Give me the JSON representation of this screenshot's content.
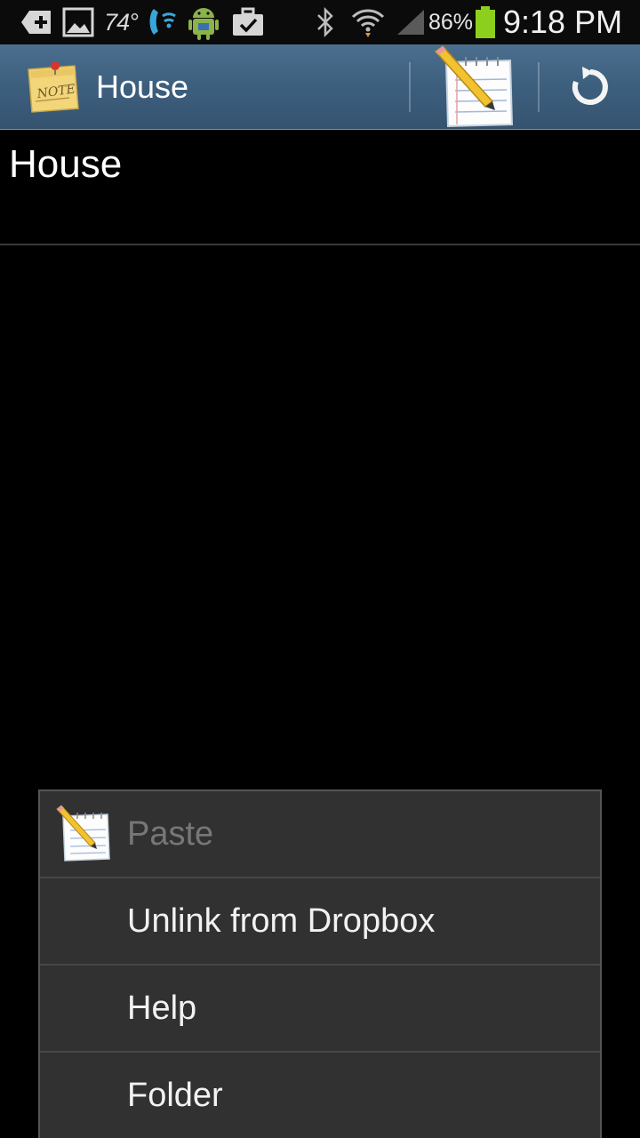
{
  "status_bar": {
    "temperature": "74°",
    "battery_percent": "86%",
    "time": "9:18 PM",
    "icons": [
      "add-icon",
      "gallery-icon",
      "wifi-calling-icon",
      "android-icon",
      "briefcase-check-icon",
      "bluetooth-icon",
      "wifi-icon",
      "signal-icon",
      "battery-icon"
    ]
  },
  "action_bar": {
    "title": "House",
    "app_icon": "note-icon",
    "new_note_icon": "notepad-pencil-icon",
    "sync_icon": "refresh-icon"
  },
  "note": {
    "title": "House"
  },
  "menu": {
    "items": [
      {
        "label": "Paste",
        "icon": "notepad-pencil-icon",
        "enabled": false
      },
      {
        "label": "Unlink from Dropbox",
        "enabled": true
      },
      {
        "label": "Help",
        "enabled": true
      },
      {
        "label": "Folder",
        "enabled": true
      }
    ]
  },
  "colors": {
    "action_bar": "#3d5f7e",
    "menu_background": "#313131",
    "battery": "#8ccf1c"
  }
}
